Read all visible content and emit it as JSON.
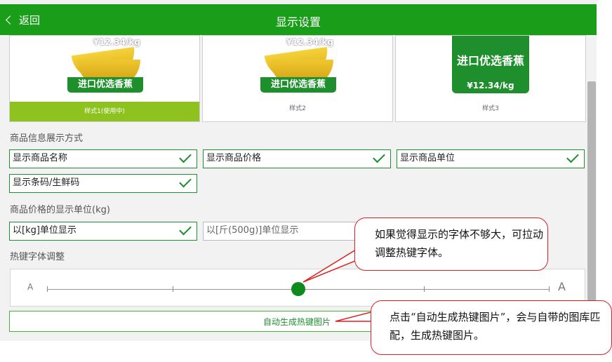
{
  "header": {
    "back_label": "返回",
    "title": "显示设置"
  },
  "styles": {
    "card1": {
      "price": "¥12.34/kg",
      "tag": "进口优选香蕉",
      "caption": "样式1(使用中)"
    },
    "card2": {
      "price": "¥12.34/kg",
      "tag": "进口优选香蕉",
      "caption": "样式2"
    },
    "card3": {
      "name": "进口优选香蕉",
      "price": "¥12.34/kg",
      "caption": "样式3"
    }
  },
  "info_section": {
    "label": "商品信息展示方式",
    "options": [
      "显示商品名称",
      "显示商品价格",
      "显示商品单位",
      "显示条码/生鲜码"
    ]
  },
  "unit_section": {
    "label": "商品价格的显示单位(kg)",
    "options": [
      "以[kg]单位显示",
      "以[斤(500g)]单位显示"
    ],
    "selected": "以[kg]单位显示"
  },
  "font_section": {
    "label": "热键字体调整",
    "small_a": "A",
    "large_a": "A",
    "slider_steps": 5,
    "slider_value_index": 2
  },
  "generate_button": "自动生成热键图片",
  "annotations": {
    "bubble1": "如果觉得显示的字体不够大，可拉动调整热键字体。",
    "bubble2": "点击“自动生成热键图片”，会与自带的图库匹配，生成热键图片。"
  },
  "colors": {
    "header": "#1a9e1a",
    "accent": "#1f8f2e",
    "active_style": "#8dc21f",
    "callout_border": "#e02020"
  }
}
